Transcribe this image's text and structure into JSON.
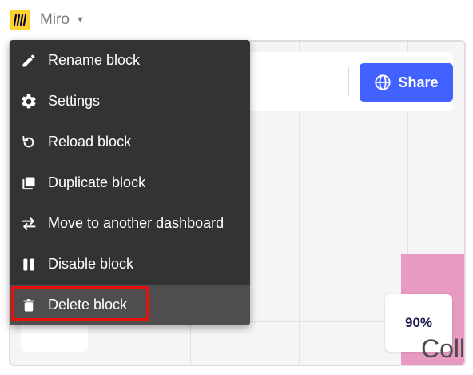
{
  "app": {
    "title": "Miro",
    "logo_icon": "miro-logo-icon",
    "logo_color": "#FFD02F"
  },
  "board": {
    "share_label": "Share",
    "share_icon": "globe-icon",
    "share_color": "#4262FF",
    "zoom_level": "90%",
    "partial_text": "Coll",
    "sticky_color": "#E89AC2"
  },
  "menu": {
    "items": [
      {
        "label": "Rename block",
        "icon": "pencil-icon"
      },
      {
        "label": "Settings",
        "icon": "gear-icon"
      },
      {
        "label": "Reload block",
        "icon": "reload-icon"
      },
      {
        "label": "Duplicate block",
        "icon": "duplicate-icon"
      },
      {
        "label": "Move to another dashboard",
        "icon": "swap-arrows-icon"
      },
      {
        "label": "Disable block",
        "icon": "pause-icon"
      },
      {
        "label": "Delete block",
        "icon": "trash-icon",
        "highlighted": true
      }
    ],
    "highlight_color": "#E8100F"
  }
}
